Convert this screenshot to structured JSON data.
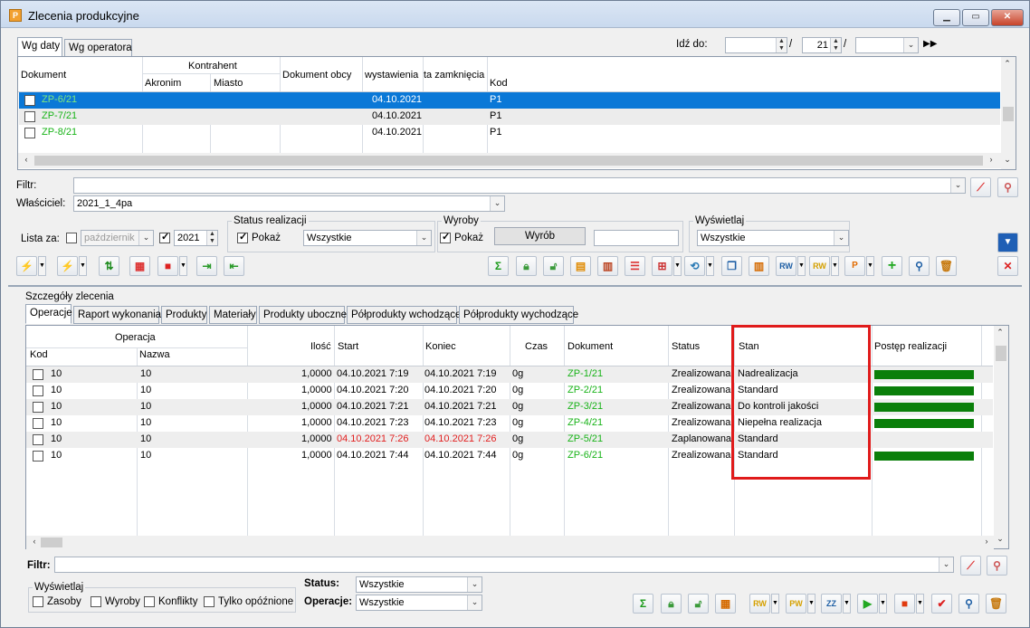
{
  "window": {
    "title": "Zlecenia produkcyjne",
    "app_icon": "P"
  },
  "top_tabs": [
    "Wg daty",
    "Wg operatora"
  ],
  "goto": {
    "label": "Idź do:",
    "year_value": "21",
    "sep1": "/",
    "sep2": "/"
  },
  "orders_table": {
    "headers": {
      "dokument": "Dokument",
      "kontrahent": "Kontrahent",
      "akronim": "Akronim",
      "miasto": "Miasto",
      "dokument_obcy": "Dokument obcy",
      "wystawienia": "wystawienia",
      "zamkniecia": "ta zamknięcia",
      "kod": "Kod"
    },
    "rows": [
      {
        "checked": true,
        "dokument": "ZP-6/21",
        "data": "04.10.2021",
        "kod": "P1"
      },
      {
        "checked": false,
        "dokument": "ZP-7/21",
        "data": "04.10.2021",
        "kod": "P1"
      },
      {
        "checked": false,
        "dokument": "ZP-8/21",
        "data": "04.10.2021",
        "kod": "P1"
      }
    ]
  },
  "filter": {
    "label": "Filtr:",
    "value": ""
  },
  "owner": {
    "label": "Właściciel:",
    "value": "2021_1_4pa"
  },
  "lista_za": {
    "label": "Lista za:",
    "month": "październik",
    "year": "2021"
  },
  "status_realizacji": {
    "label": "Status realizacji",
    "pokaz": "Pokaż",
    "value": "Wszystkie"
  },
  "wyroby": {
    "label": "Wyroby",
    "pokaz": "Pokaż",
    "button": "Wyrób",
    "value": ""
  },
  "wyswietlaj_top": {
    "label": "Wyświetlaj",
    "value": "Wszystkie"
  },
  "details": {
    "label": "Szczegóły zlecenia",
    "tabs": [
      "Operacje",
      "Raport wykonania",
      "Produkty",
      "Materiały",
      "Produkty uboczne",
      "Półprodukty wchodzące",
      "Półprodukty wychodzące"
    ]
  },
  "ops_table": {
    "headers": {
      "operacja": "Operacja",
      "kod": "Kod",
      "nazwa": "Nazwa",
      "ilosc": "Ilość",
      "start": "Start",
      "koniec": "Koniec",
      "czas": "Czas",
      "dokument": "Dokument",
      "status": "Status",
      "stan": "Stan",
      "postep": "Postęp realizacji"
    },
    "rows": [
      {
        "kod": "10",
        "nazwa": "10",
        "ilosc": "1,0000",
        "start": "04.10.2021 7:19",
        "koniec": "04.10.2021 7:19",
        "czas": "0g",
        "dokument": "ZP-1/21",
        "status": "Zrealizowana",
        "stan": "Nadrealizacja",
        "progress": 1.0,
        "late": false
      },
      {
        "kod": "10",
        "nazwa": "10",
        "ilosc": "1,0000",
        "start": "04.10.2021 7:20",
        "koniec": "04.10.2021 7:20",
        "czas": "0g",
        "dokument": "ZP-2/21",
        "status": "Zrealizowana",
        "stan": "Standard",
        "progress": 1.0,
        "late": false
      },
      {
        "kod": "10",
        "nazwa": "10",
        "ilosc": "1,0000",
        "start": "04.10.2021 7:21",
        "koniec": "04.10.2021 7:21",
        "czas": "0g",
        "dokument": "ZP-3/21",
        "status": "Zrealizowana",
        "stan": "Do kontroli jakości",
        "progress": 1.0,
        "late": false
      },
      {
        "kod": "10",
        "nazwa": "10",
        "ilosc": "1,0000",
        "start": "04.10.2021 7:23",
        "koniec": "04.10.2021 7:23",
        "czas": "0g",
        "dokument": "ZP-4/21",
        "status": "Zrealizowana",
        "stan": "Niepełna realizacja",
        "progress": 1.0,
        "late": false
      },
      {
        "kod": "10",
        "nazwa": "10",
        "ilosc": "1,0000",
        "start": "04.10.2021 7:26",
        "koniec": "04.10.2021 7:26",
        "czas": "0g",
        "dokument": "ZP-5/21",
        "status": "Zaplanowana",
        "stan": "Standard",
        "progress": 0,
        "late": true
      },
      {
        "kod": "10",
        "nazwa": "10",
        "ilosc": "1,0000",
        "start": "04.10.2021 7:44",
        "koniec": "04.10.2021 7:44",
        "czas": "0g",
        "dokument": "ZP-6/21",
        "status": "Zrealizowana",
        "stan": "Standard",
        "progress": 1.0,
        "late": false
      }
    ]
  },
  "bottom": {
    "filter_label": "Filtr:",
    "wyswietlaj": "Wyświetlaj",
    "zasoby": "Zasoby",
    "wyroby": "Wyroby",
    "konflikty": "Konflikty",
    "tylko": "Tylko opóźnione",
    "status_label": "Status:",
    "status_value": "Wszystkie",
    "operacje_label": "Operacje:",
    "operacje_value": "Wszystkie"
  },
  "colors": {
    "selected_row": "#0a78d7",
    "doc_green": "#19b319",
    "late_red": "#e22020",
    "progress_green": "#0a7f0a",
    "highlight_box": "#e01b1b"
  }
}
